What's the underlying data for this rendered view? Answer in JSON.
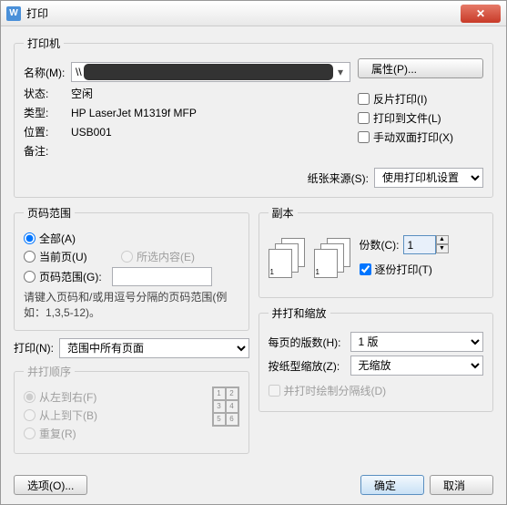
{
  "title": "打印",
  "printer": {
    "legend": "打印机",
    "name_label": "名称(M):",
    "name_prefix": "\\\\",
    "properties_btn": "属性(P)...",
    "status_label": "状态:",
    "status_value": "空闲",
    "type_label": "类型:",
    "type_value": "HP LaserJet M1319f MFP",
    "location_label": "位置:",
    "location_value": "USB001",
    "comment_label": "备注:",
    "comment_value": "",
    "chk_reverse": "反片打印(I)",
    "chk_tofile": "打印到文件(L)",
    "chk_duplex": "手动双面打印(X)",
    "source_label": "纸张来源(S):",
    "source_value": "使用打印机设置"
  },
  "range": {
    "legend": "页码范围",
    "all": "全部(A)",
    "current": "当前页(U)",
    "selection": "所选内容(E)",
    "pages": "页码范围(G):",
    "pages_value": "",
    "hint": "请键入页码和/或用逗号分隔的页码范围(例如：1,3,5-12)。"
  },
  "copies": {
    "legend": "副本",
    "count_label": "份数(C):",
    "count_value": "1",
    "collate": "逐份打印(T)"
  },
  "print_what": {
    "label": "打印(N):",
    "value": "范围中所有页面"
  },
  "order": {
    "legend": "并打顺序",
    "lr": "从左到右(F)",
    "tb": "从上到下(B)",
    "repeat": "重复(R)"
  },
  "scale": {
    "legend": "并打和缩放",
    "pages_per_label": "每页的版数(H):",
    "pages_per_value": "1 版",
    "fit_label": "按纸型缩放(Z):",
    "fit_value": "无缩放",
    "draw_line": "并打时绘制分隔线(D)"
  },
  "footer": {
    "options": "选项(O)...",
    "ok": "确定",
    "cancel": "取消"
  }
}
